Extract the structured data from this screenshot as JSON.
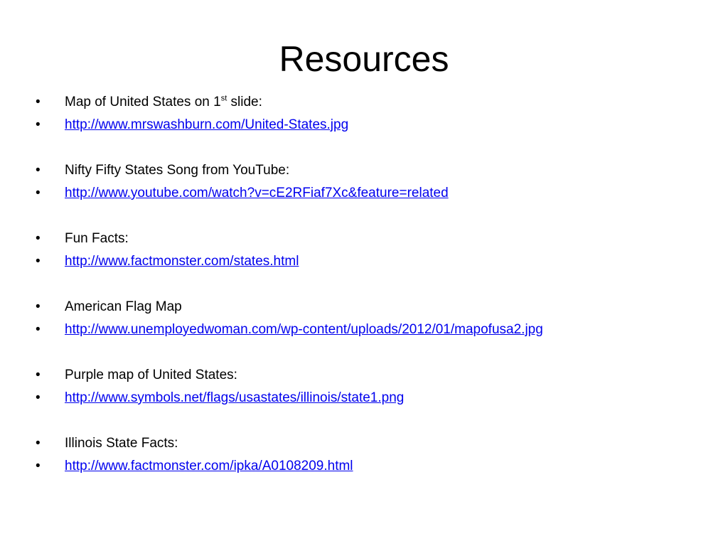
{
  "slide": {
    "title": "Resources",
    "bullet_char": "•",
    "items": [
      {
        "pre": "Map of United States on 1",
        "sup": "st",
        "post": " slide:"
      },
      {
        "link": "http://www.mrswashburn.com/United-States.jpg"
      },
      {
        "text": "Nifty Fifty States Song from YouTube:"
      },
      {
        "link": "http://www.youtube.com/watch?v=cE2RFiaf7Xc&feature=related"
      },
      {
        "text": "Fun Facts:"
      },
      {
        "link": "http://www.factmonster.com/states.html"
      },
      {
        "text": "American Flag Map"
      },
      {
        "link": "http://www.unemployedwoman.com/wp-content/uploads/2012/01/mapofusa2.jpg"
      },
      {
        "text": "Purple map of United States:"
      },
      {
        "link": "http://www.symbols.net/flags/usastates/illinois/state1.png"
      },
      {
        "text": "Illinois State Facts:"
      },
      {
        "link": "http://www.factmonster.com/ipka/A0108209.html"
      }
    ],
    "colors": {
      "background": "#ffffff",
      "text": "#000000",
      "link": "#0000ee"
    }
  }
}
